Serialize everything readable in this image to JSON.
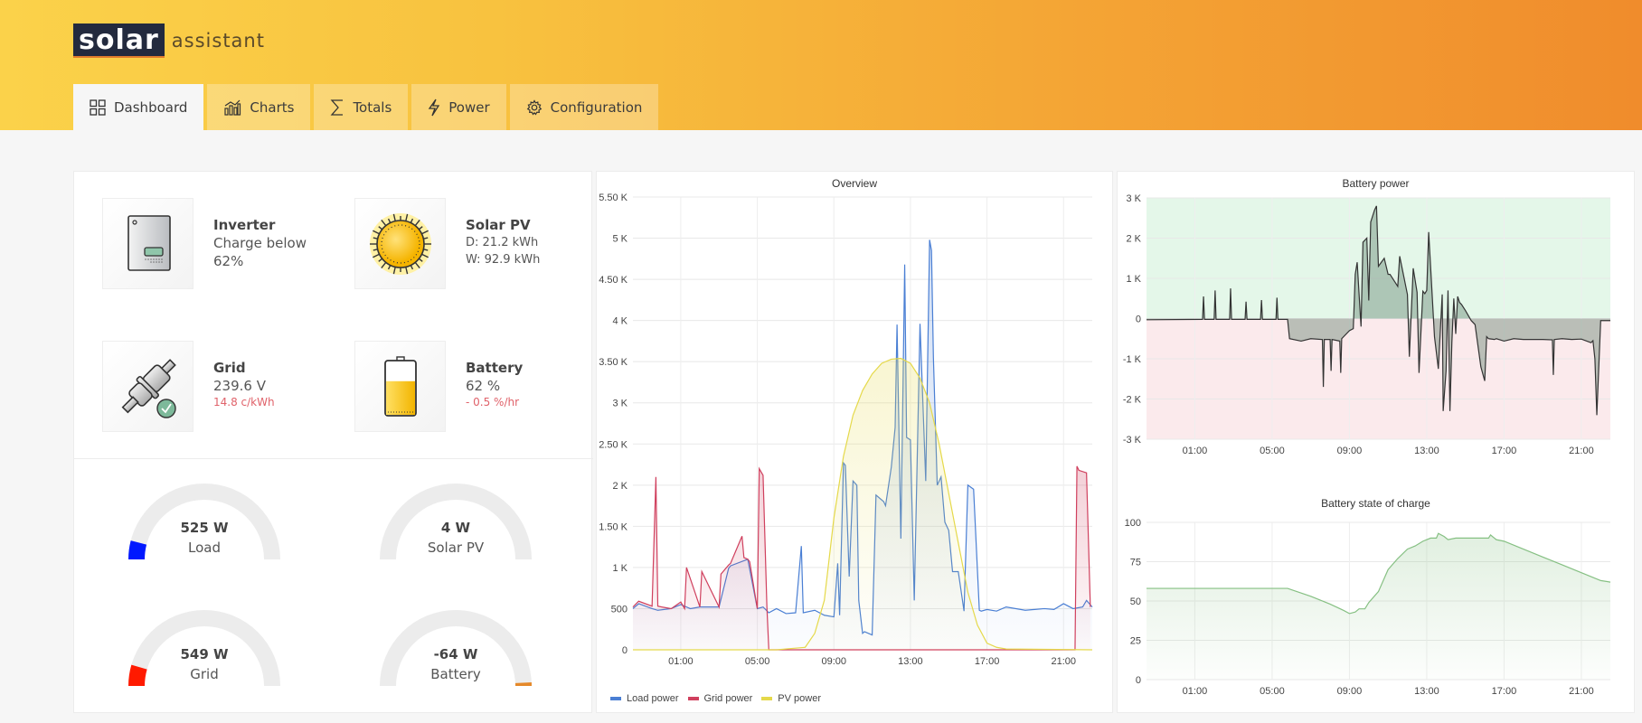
{
  "app": {
    "logo_primary": "solar",
    "logo_secondary": "assistant"
  },
  "colors": {
    "load": "#4a7fd4",
    "grid": "#d0405e",
    "pv": "#e5d94a",
    "battery_line": "#333333",
    "charge_zone": "#e4f7e9",
    "discharge_zone": "#fbeaec",
    "soc": "#86c083",
    "gauge_load": "#0018ff",
    "gauge_grid": "#ff1a00",
    "gauge_battery": "#e5892a",
    "gauge_track": "#ececec"
  },
  "tabs": [
    {
      "label": "Dashboard",
      "icon": "grid-icon",
      "active": true
    },
    {
      "label": "Charts",
      "icon": "bar-chart-icon",
      "active": false
    },
    {
      "label": "Totals",
      "icon": "sigma-icon",
      "active": false
    },
    {
      "label": "Power",
      "icon": "lightning-icon",
      "active": false
    },
    {
      "label": "Configuration",
      "icon": "gear-icon",
      "active": false
    }
  ],
  "status": {
    "inverter": {
      "title": "Inverter",
      "line1": "Charge below",
      "line2": "62%"
    },
    "solar": {
      "title": "Solar PV",
      "line1": "D: 21.2 kWh",
      "line2": "W: 92.9 kWh"
    },
    "grid": {
      "title": "Grid",
      "line1": "239.6 V",
      "line2": "14.8 c/kWh"
    },
    "battery": {
      "title": "Battery",
      "line1": "62 %",
      "line2": "- 0.5 %/hr",
      "soc_fraction": 0.62
    }
  },
  "gauges": [
    {
      "value": "525 W",
      "label": "Load",
      "fraction": 0.08,
      "side": "left",
      "color_key": "gauge_load"
    },
    {
      "value": "4 W",
      "label": "Solar PV",
      "fraction": 0.0,
      "side": "left",
      "color_key": "gauge_load"
    },
    {
      "value": "549 W",
      "label": "Grid",
      "fraction": 0.09,
      "side": "left",
      "color_key": "gauge_grid"
    },
    {
      "value": "-64 W",
      "label": "Battery",
      "fraction": 0.015,
      "side": "right",
      "color_key": "gauge_battery"
    }
  ],
  "chart_data": [
    {
      "id": "overview",
      "type": "line",
      "title": "Overview",
      "xlabel": "",
      "ylabel": "",
      "x_ticks": [
        "01:00",
        "05:00",
        "09:00",
        "13:00",
        "17:00",
        "21:00"
      ],
      "x_range_hours": [
        -1.5,
        22.5
      ],
      "y_ticks": [
        "0",
        "500",
        "1 K",
        "1.50 K",
        "2 K",
        "2.50 K",
        "3 K",
        "3.50 K",
        "4 K",
        "4.50 K",
        "5 K",
        "5.50 K"
      ],
      "ylim": [
        0,
        5500
      ],
      "grid": true,
      "legend_position": "bottom-left",
      "series": [
        {
          "name": "Load power",
          "color_key": "load",
          "x": [
            -1.5,
            -1.2,
            -0.5,
            -0.2,
            0.5,
            1.0,
            1.5,
            2.0,
            3.0,
            3.5,
            3.6,
            4.5,
            5.0,
            5.3,
            5.6,
            6.0,
            6.5,
            7.0,
            7.3,
            7.4,
            8.0,
            8.5,
            9.0,
            9.2,
            9.3,
            9.5,
            9.6,
            9.8,
            10.0,
            10.2,
            10.3,
            10.5,
            10.6,
            11.0,
            11.2,
            11.6,
            11.7,
            12.0,
            12.2,
            12.3,
            12.5,
            12.7,
            12.8,
            13.0,
            13.2,
            13.5,
            13.8,
            14.0,
            14.1,
            14.2,
            14.4,
            14.5,
            14.6,
            14.8,
            15.0,
            15.2,
            15.5,
            15.8,
            16.0,
            16.3,
            16.6,
            16.7,
            17.0,
            17.5,
            18.0,
            19.0,
            20.0,
            20.5,
            21.0,
            21.5,
            22.0,
            22.2,
            22.5
          ],
          "y": [
            500,
            560,
            500,
            480,
            500,
            550,
            500,
            520,
            520,
            990,
            1020,
            1100,
            500,
            520,
            450,
            500,
            440,
            450,
            1260,
            450,
            480,
            420,
            400,
            1050,
            420,
            2270,
            2240,
            890,
            2050,
            2000,
            600,
            200,
            220,
            180,
            1880,
            1800,
            1750,
            2220,
            2700,
            3950,
            1350,
            4680,
            2580,
            2550,
            600,
            3960,
            2050,
            4980,
            4850,
            3550,
            2000,
            2050,
            2100,
            1550,
            1450,
            950,
            950,
            470,
            2000,
            1950,
            480,
            470,
            490,
            470,
            520,
            480,
            500,
            490,
            560,
            500,
            520,
            600,
            520
          ]
        },
        {
          "name": "Grid power",
          "color_key": "grid",
          "x": [
            -1.5,
            -1.2,
            -0.5,
            -0.3,
            -0.2,
            0.0,
            0.5,
            1.0,
            1.2,
            1.3,
            2.0,
            2.1,
            3.0,
            3.1,
            3.5,
            3.6,
            4.2,
            4.3,
            4.5,
            4.6,
            5.0,
            5.1,
            5.3,
            5.5,
            5.6,
            5.7,
            21.6,
            21.7,
            21.8,
            22.2,
            22.4
          ],
          "y": [
            520,
            590,
            530,
            2100,
            530,
            520,
            500,
            580,
            500,
            1000,
            520,
            950,
            520,
            920,
            1030,
            1050,
            1380,
            1120,
            1100,
            1070,
            500,
            2200,
            2120,
            520,
            0,
            0,
            0,
            2230,
            2180,
            2150,
            520
          ]
        },
        {
          "name": "PV power",
          "color_key": "pv",
          "x": [
            -1.5,
            6.0,
            7.5,
            8.0,
            8.5,
            9.0,
            9.5,
            10.0,
            10.5,
            11.0,
            11.5,
            12.0,
            12.5,
            13.0,
            13.5,
            14.0,
            14.5,
            15.0,
            15.5,
            16.0,
            16.5,
            17.0,
            17.5,
            18.0,
            22.5
          ],
          "y": [
            0,
            0,
            30,
            200,
            600,
            1600,
            2350,
            2850,
            3150,
            3350,
            3480,
            3530,
            3540,
            3480,
            3300,
            3000,
            2500,
            1900,
            1300,
            700,
            300,
            80,
            30,
            10,
            0
          ]
        }
      ]
    },
    {
      "id": "battery-power",
      "type": "area",
      "title": "Battery power",
      "x_ticks": [
        "01:00",
        "05:00",
        "09:00",
        "13:00",
        "17:00",
        "21:00"
      ],
      "x_range_hours": [
        -1.5,
        22.5
      ],
      "y_ticks": [
        "-3 K",
        "-2 K",
        "-1 K",
        "0",
        "1 K",
        "2 K",
        "3 K"
      ],
      "ylim": [
        -3000,
        3000
      ],
      "grid": true,
      "series": [
        {
          "name": "Battery power",
          "color_key": "battery_line",
          "x": [
            -1.5,
            1.4,
            1.45,
            1.5,
            2.0,
            2.05,
            2.1,
            2.8,
            2.85,
            2.9,
            3.6,
            3.65,
            3.7,
            4.4,
            4.45,
            4.5,
            5.2,
            5.25,
            5.3,
            5.8,
            5.9,
            6.5,
            7.0,
            7.6,
            7.65,
            7.7,
            8.0,
            8.05,
            8.1,
            8.5,
            8.55,
            8.6,
            9.0,
            9.2,
            9.3,
            9.4,
            9.6,
            9.7,
            9.9,
            10.0,
            10.1,
            10.3,
            10.4,
            10.5,
            10.8,
            11.0,
            11.1,
            11.5,
            11.6,
            12.0,
            12.1,
            12.3,
            12.5,
            12.6,
            12.8,
            12.9,
            13.0,
            13.1,
            13.4,
            13.6,
            13.8,
            13.85,
            14.0,
            14.1,
            14.2,
            14.3,
            14.4,
            14.5,
            14.6,
            14.7,
            14.8,
            15.0,
            15.3,
            15.5,
            15.8,
            16.0,
            16.1,
            16.2,
            16.5,
            16.6,
            16.8,
            17.0,
            17.5,
            18.0,
            19.0,
            19.5,
            19.55,
            19.6,
            20.0,
            20.5,
            21.0,
            21.5,
            21.6,
            21.7,
            21.8,
            22.0,
            22.5
          ],
          "y": [
            -30,
            -20,
            550,
            -20,
            -20,
            700,
            -20,
            -20,
            750,
            -20,
            -20,
            420,
            -20,
            -20,
            460,
            -20,
            -20,
            520,
            -20,
            -20,
            -500,
            -560,
            -500,
            -520,
            -1700,
            -520,
            -520,
            -1300,
            -520,
            -560,
            -1350,
            -500,
            -300,
            -250,
            1100,
            1400,
            -200,
            1900,
            2000,
            450,
            2400,
            2700,
            2800,
            1300,
            1500,
            1100,
            1100,
            800,
            1550,
            600,
            -950,
            1250,
            650,
            -1350,
            680,
            620,
            700,
            2150,
            -450,
            -1250,
            600,
            -2300,
            -1300,
            700,
            -2300,
            -600,
            500,
            -380,
            550,
            400,
            350,
            200,
            -50,
            -150,
            -1200,
            -1550,
            -450,
            -500,
            -520,
            -500,
            -530,
            -560,
            -500,
            -520,
            -520,
            -530,
            -1400,
            -520,
            -500,
            -520,
            -510,
            -600,
            -550,
            -1000,
            -2400,
            -50,
            -50
          ]
        }
      ]
    },
    {
      "id": "battery-soc",
      "type": "area",
      "title": "Battery state of charge",
      "x_ticks": [
        "01:00",
        "05:00",
        "09:00",
        "13:00",
        "17:00",
        "21:00"
      ],
      "x_range_hours": [
        -1.5,
        22.5
      ],
      "y_ticks": [
        "0",
        "25",
        "50",
        "75",
        "100"
      ],
      "ylim": [
        0,
        100
      ],
      "grid": true,
      "series": [
        {
          "name": "Battery state of charge",
          "color_key": "soc",
          "x": [
            -1.5,
            5.8,
            7.0,
            8.0,
            8.7,
            9.0,
            9.3,
            9.5,
            9.8,
            10.0,
            10.5,
            11.0,
            11.5,
            12.0,
            12.4,
            12.8,
            13.2,
            13.5,
            13.6,
            13.9,
            14.1,
            14.5,
            15.0,
            15.5,
            16.0,
            16.2,
            16.3,
            16.6,
            17.0,
            18.0,
            19.0,
            20.0,
            21.0,
            22.0,
            22.5
          ],
          "y": [
            58,
            58,
            53,
            48,
            44,
            42,
            43,
            45,
            45,
            49,
            56,
            70,
            77,
            83,
            85,
            88,
            90,
            90,
            93,
            91,
            89,
            90,
            90,
            90,
            90,
            90,
            92,
            89,
            88,
            83,
            78,
            73,
            68,
            63,
            62
          ]
        }
      ]
    }
  ]
}
